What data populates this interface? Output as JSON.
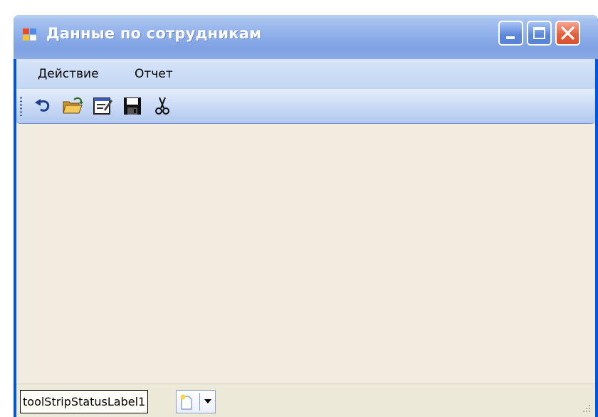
{
  "window": {
    "title": "Данные по сотрудникам"
  },
  "menu": {
    "items": [
      {
        "label": "Действие"
      },
      {
        "label": "Отчет"
      }
    ]
  },
  "toolbar": {
    "buttons": [
      {
        "icon": "undo-icon"
      },
      {
        "icon": "open-folder-icon"
      },
      {
        "icon": "edit-form-icon"
      },
      {
        "icon": "save-icon"
      },
      {
        "icon": "cut-icon"
      }
    ]
  },
  "statusbar": {
    "label": "toolStripStatusLabel1",
    "split_button_icon": "new-document-icon"
  },
  "colors": {
    "title_bar": "#8fb0ea",
    "client_area": "#f1ebe0",
    "close_button": "#e4623f"
  }
}
